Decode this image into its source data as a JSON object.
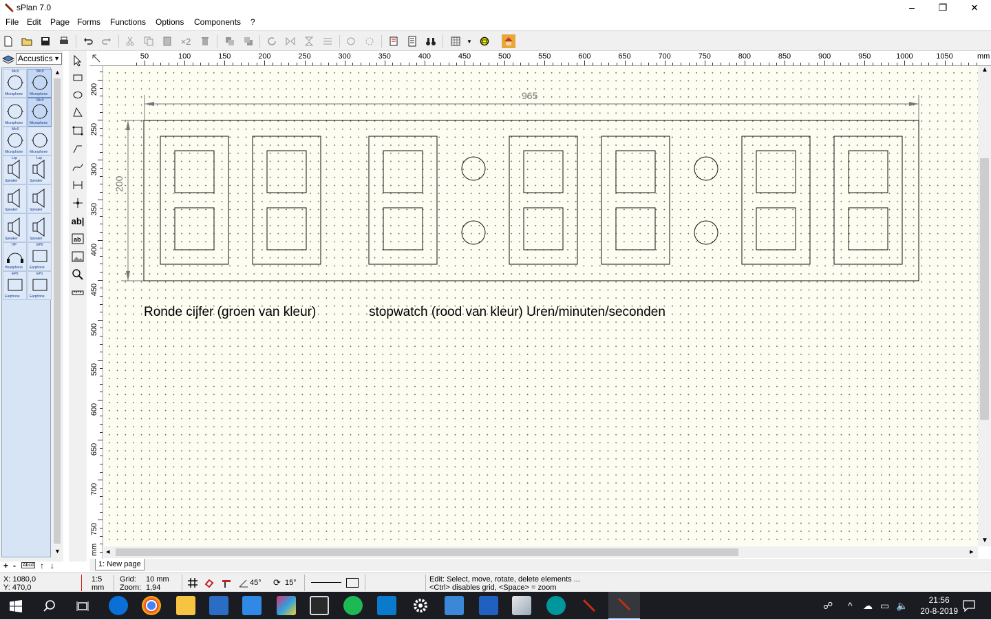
{
  "window": {
    "title": "sPlan 7.0",
    "minimize": "–",
    "maximize": "❐",
    "close": "✕"
  },
  "menu": [
    "File",
    "Edit",
    "Page",
    "Forms",
    "Functions",
    "Options",
    "Components",
    "?"
  ],
  "toolbar": {
    "copies_label": "×2"
  },
  "library": {
    "selected": "Accustics",
    "cells": [
      {
        "label": "Mic0",
        "caption": "Microphone"
      },
      {
        "label": "Mic0",
        "caption": "Microphone"
      },
      {
        "label": "",
        "caption": "Microphone"
      },
      {
        "label": "Mic0",
        "caption": "Microphone"
      },
      {
        "label": "Mic0",
        "caption": "Microphone"
      },
      {
        "label": "",
        "caption": "Microphone"
      },
      {
        "label": "Lsp",
        "caption": "Speaker"
      },
      {
        "label": "Lsp",
        "caption": "Speaker"
      },
      {
        "label": "",
        "caption": "Speaker"
      },
      {
        "label": "",
        "caption": "Speaker"
      },
      {
        "label": "",
        "caption": "Speaker"
      },
      {
        "label": "",
        "caption": "Speaker"
      },
      {
        "label": "HP",
        "caption": "Headphone"
      },
      {
        "label": "EP0",
        "caption": "Earphone"
      },
      {
        "label": "EP0",
        "caption": "Earphone"
      },
      {
        "label": "EP1",
        "caption": "Earphone"
      }
    ],
    "bottom_buttons": [
      "+",
      "-",
      "Abcd",
      "↑",
      "↓"
    ]
  },
  "rulers": {
    "top_ticks": [
      "50",
      "100",
      "150",
      "200",
      "250",
      "300",
      "350",
      "400",
      "450",
      "500",
      "550",
      "600",
      "650",
      "700",
      "750",
      "800",
      "850",
      "900",
      "950",
      "1000",
      "1050"
    ],
    "top_unit": "mm",
    "left_ticks": [
      "200",
      "250",
      "300",
      "350",
      "400",
      "450",
      "500",
      "550",
      "600",
      "650",
      "700",
      "750"
    ],
    "left_unit": "mm"
  },
  "drawing": {
    "dimension_width": "965",
    "dimension_height": "200",
    "caption_left": "Ronde cijfer (groen van kleur)",
    "caption_right": "stopwatch (rood van kleur) Uren/minuten/seconden"
  },
  "page_tab": "1: New page",
  "status": {
    "x": "X: 1080,0",
    "y": "Y: 470,0",
    "scale": "1:5",
    "scale_unit": "mm",
    "grid_label": "Grid:",
    "grid_value": "10 mm",
    "zoom_label": "Zoom:",
    "zoom_value": "1,94",
    "angle1": "45°",
    "angle2": "15°",
    "hint1": "Edit: Select, move, rotate, delete elements ...",
    "hint2": "<Ctrl> disables grid, <Space> = zoom"
  },
  "taskbar": {
    "time": "21:56",
    "date": "20-8-2019"
  }
}
